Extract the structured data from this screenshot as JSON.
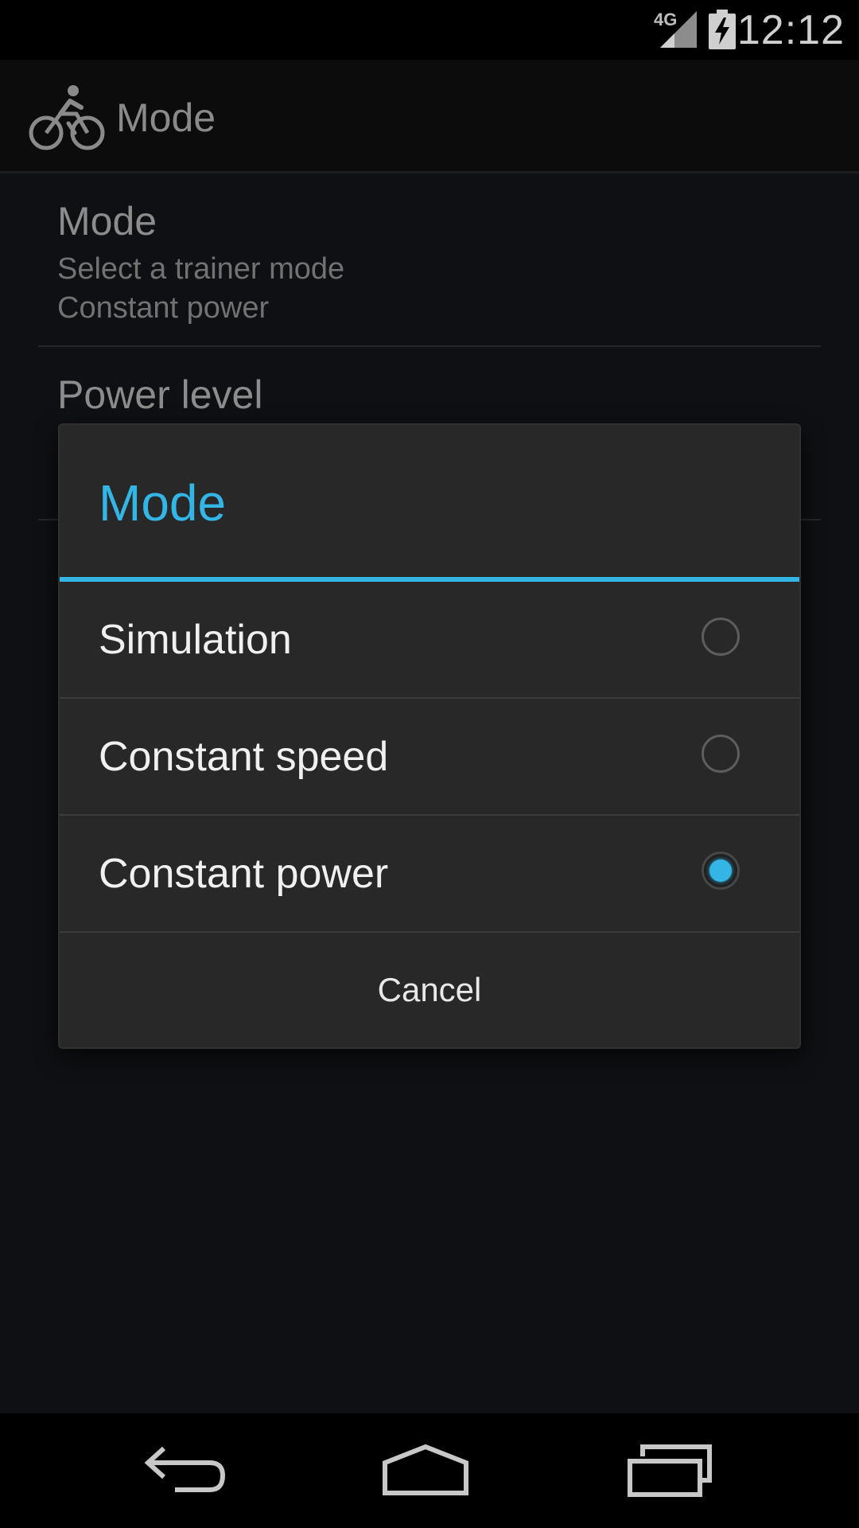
{
  "status_bar": {
    "time": "12:12",
    "network_type": "4G",
    "icons": [
      "signal-icon",
      "battery-charging-icon"
    ]
  },
  "action_bar": {
    "title": "Mode",
    "icon": "bicycle-icon"
  },
  "preferences": [
    {
      "title": "Mode",
      "summary_lines": [
        "Select a trainer mode",
        "Constant power"
      ]
    },
    {
      "title": "Power level",
      "summary_lines": []
    }
  ],
  "dialog": {
    "title": "Mode",
    "options": [
      {
        "label": "Simulation",
        "checked": false
      },
      {
        "label": "Constant speed",
        "checked": false
      },
      {
        "label": "Constant power",
        "checked": true
      }
    ],
    "cancel_label": "Cancel"
  },
  "nav_bar": {
    "icons": [
      "back-icon",
      "home-icon",
      "recents-icon"
    ]
  },
  "colors": {
    "accent": "#33b5e5",
    "dialog_background": "#282828",
    "screen_background": "#0f1013"
  }
}
